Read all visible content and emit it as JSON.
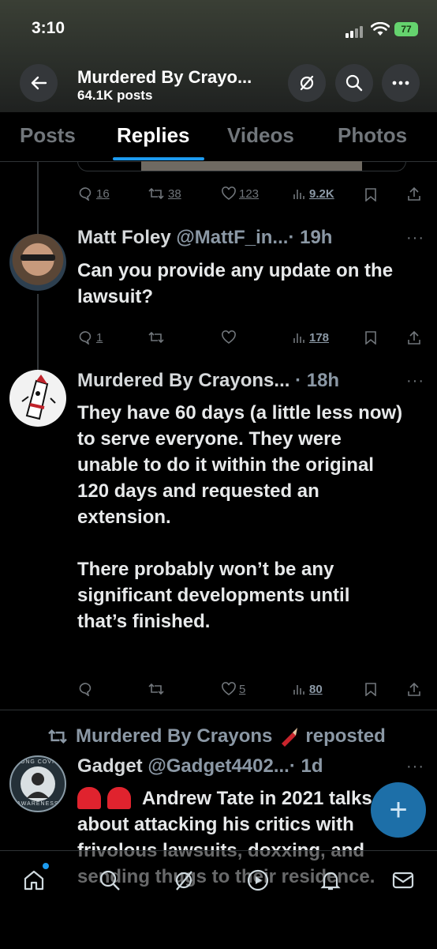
{
  "status": {
    "time": "3:10",
    "battery": "77"
  },
  "header": {
    "title": "Murdered By Crayo...",
    "subtitle": "64.1K posts",
    "icons": [
      "back-arrow-icon",
      "slash-circle-icon",
      "search-icon",
      "more-icon"
    ]
  },
  "tabs": [
    "Posts",
    "Replies",
    "Videos",
    "Photos"
  ],
  "prev_actions": {
    "replies": "16",
    "reposts": "38",
    "likes": "123",
    "views": "9.2K"
  },
  "tweets": [
    {
      "name": "Matt Foley",
      "handle": "@MattF_in...",
      "time": "· 19h",
      "text": "Can you provide any update on the lawsuit?",
      "replies": "1",
      "reposts": "",
      "likes": "",
      "views": "178"
    },
    {
      "name": "Murdered By Crayons...",
      "handle": "",
      "time": "· 18h",
      "text": "They have 60 days (a little less now) to serve everyone. They were unable to do it within the original 120 days and requested an extension.\n\nThere probably won’t be any significant developments until that’s finished.",
      "replies": "",
      "reposts": "",
      "likes": "5",
      "views": "80"
    },
    {
      "repost_label": "Murdered By Crayons",
      "repost_suffix": "reposted",
      "name": "Gadget",
      "handle": "@Gadget4402...",
      "time": "· 1d",
      "text": "Andrew Tate in 2021 talks about attacking his critics with frivolous lawsuits, doxxing, and sending thugs to their residence."
    }
  ],
  "avatar_badges": {
    "awareness_top": "LONG COVID",
    "awareness_bottom": "AWARENESS"
  },
  "nav_icons": [
    "home-icon",
    "search-icon",
    "grok-icon",
    "communities-icon",
    "notifications-icon",
    "messages-icon"
  ],
  "colors": {
    "accent": "#1d9bf0",
    "fab": "#1d6fa8",
    "bg": "#000000"
  }
}
